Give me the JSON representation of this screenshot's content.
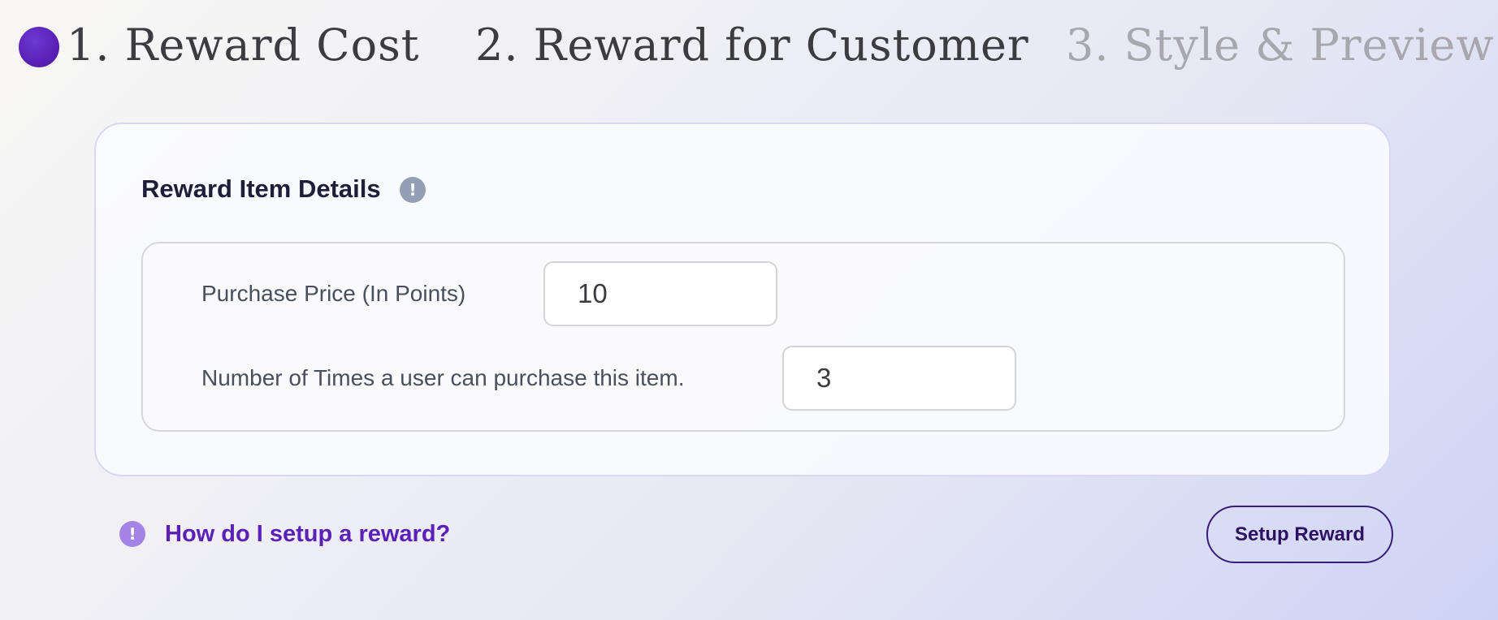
{
  "stepper": {
    "steps": [
      {
        "label": "1. Reward Cost",
        "state": "active"
      },
      {
        "label": "2. Reward for Customer",
        "state": "upcoming"
      },
      {
        "label": "3. Style & Preview",
        "state": "disabled"
      }
    ],
    "active_color": "#5b21b6"
  },
  "card": {
    "title": "Reward Item Details",
    "info_icon": "exclamation-circle-icon",
    "info_glyph": "!",
    "fields": {
      "purchase_price": {
        "label": "Purchase Price (In Points)",
        "value": "10"
      },
      "purchase_limit": {
        "label": "Number of Times a user can purchase this item.",
        "value": "3"
      }
    }
  },
  "footer": {
    "help_icon": "exclamation-circle-icon",
    "help_glyph": "!",
    "help_link": "How do I setup a reward?",
    "setup_button": "Setup Reward",
    "accent_color": "#5b21b6"
  }
}
